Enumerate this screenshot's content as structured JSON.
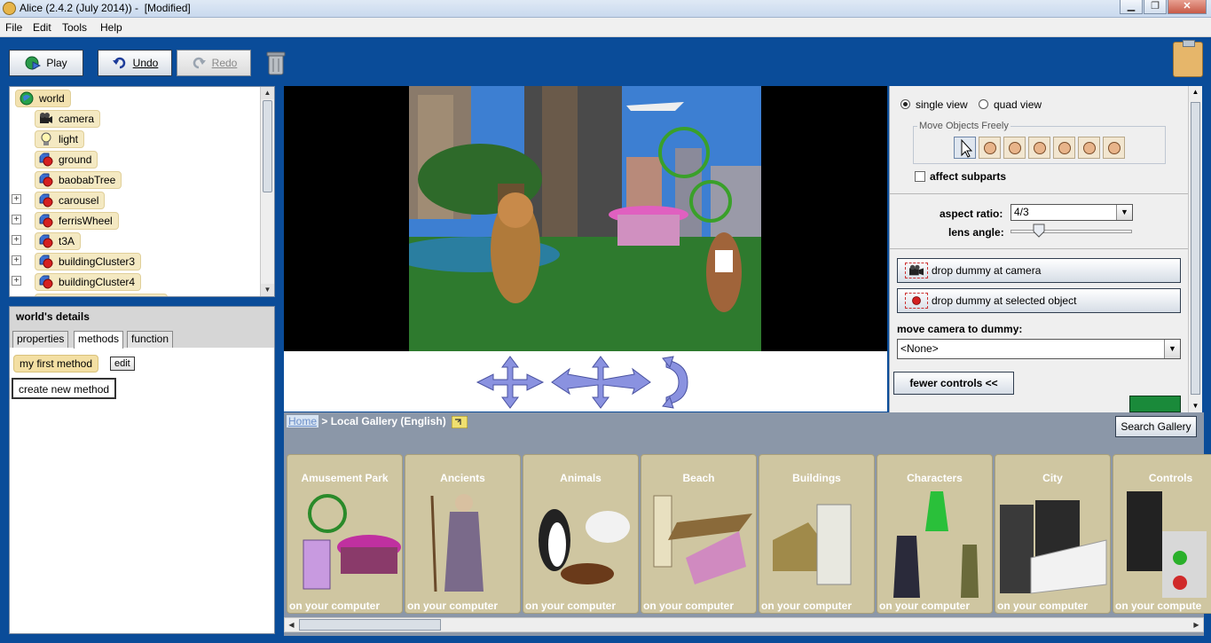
{
  "window": {
    "title": "Alice (2.4.2 (July 2014)) -  [Modified]",
    "controls": [
      "minimize",
      "maximize",
      "close"
    ]
  },
  "menu": {
    "items": [
      "File",
      "Edit",
      "Tools",
      "Help"
    ]
  },
  "toolbar": {
    "play_label": "Play",
    "undo_label": "Undo",
    "redo_label": "Redo"
  },
  "object_tree": {
    "items": [
      {
        "label": "world",
        "icon": "globe-icon",
        "expandable": false
      },
      {
        "label": "camera",
        "icon": "camera-icon",
        "expandable": false
      },
      {
        "label": "light",
        "icon": "lightbulb-icon",
        "expandable": false
      },
      {
        "label": "ground",
        "icon": "object-icon",
        "expandable": false
      },
      {
        "label": "baobabTree",
        "icon": "object-icon",
        "expandable": false
      },
      {
        "label": "carousel",
        "icon": "object-icon",
        "expandable": true
      },
      {
        "label": "ferrisWheel",
        "icon": "object-icon",
        "expandable": true
      },
      {
        "label": "t3A",
        "icon": "object-icon",
        "expandable": true
      },
      {
        "label": "buildingCluster3",
        "icon": "object-icon",
        "expandable": true
      },
      {
        "label": "buildingCluster4",
        "icon": "object-icon",
        "expandable": true
      }
    ]
  },
  "details": {
    "title": "world's details",
    "tabs": [
      "properties",
      "methods",
      "function"
    ],
    "active_tab": "methods",
    "method_name": "my first method",
    "edit_label": "edit",
    "create_label": "create new method"
  },
  "controls": {
    "view_single": "single view",
    "view_quad": "quad view",
    "selected_view": "single view",
    "move_group_label": "Move Objects Freely",
    "affect_subparts": "affect subparts",
    "affect_subparts_checked": false,
    "aspect_ratio_label": "aspect ratio:",
    "aspect_ratio_value": "4/3",
    "lens_angle_label": "lens angle:",
    "lens_angle_level": 0.2,
    "drop_camera": "drop dummy at camera",
    "drop_selected": "drop dummy at selected object",
    "move_camera_label": "move camera to dummy:",
    "move_camera_value": "<None>",
    "fewer_controls": "fewer controls  <<"
  },
  "gallery": {
    "home": "Home",
    "path": " > Local Gallery (English)",
    "search_label": "Search Gallery",
    "tiles": [
      {
        "name": "Amusement Park",
        "sub": "on your computer"
      },
      {
        "name": "Ancients",
        "sub": "on your computer"
      },
      {
        "name": "Animals",
        "sub": "on your computer"
      },
      {
        "name": "Beach",
        "sub": "on your computer"
      },
      {
        "name": "Buildings",
        "sub": "on your computer"
      },
      {
        "name": "Characters",
        "sub": "on your computer"
      },
      {
        "name": "City",
        "sub": "on your computer"
      },
      {
        "name": "Controls",
        "sub": "on your compute"
      }
    ]
  },
  "colors": {
    "background": "#0a4c99",
    "tile_bg": "#cfc6a1",
    "gallery_bg": "#8b97a8"
  }
}
